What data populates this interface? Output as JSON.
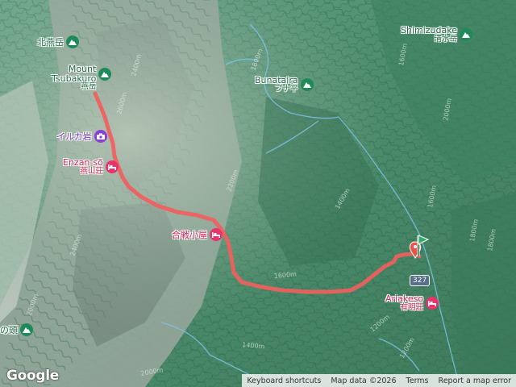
{
  "map": {
    "provider_logo": "Google",
    "route_color": "#f0605e",
    "start_flag_color": "#3aa86a",
    "end_marker_color": "#e8534a",
    "road_number": "327"
  },
  "places": [
    {
      "id": "kitatsubakurodake",
      "name": "北燕岳",
      "sub": "",
      "icon": "mountain-icon",
      "category": "peak"
    },
    {
      "id": "tsubakuro",
      "name": "Mount",
      "name2": "Tsubakuro",
      "sub": "燕岳",
      "icon": "mountain-icon",
      "category": "peak"
    },
    {
      "id": "iruka",
      "name": "イルカ岩",
      "sub": "",
      "icon": "camera-icon",
      "category": "sight"
    },
    {
      "id": "enzanso",
      "name": "Enzan-sō",
      "sub": "燕山荘",
      "icon": "bed-icon",
      "category": "lodging"
    },
    {
      "id": "kassen",
      "name": "合戦小屋",
      "sub": "",
      "icon": "bed-icon",
      "category": "lodging"
    },
    {
      "id": "bunataira",
      "name": "Bunataira",
      "sub": "ブナ平",
      "icon": "mountain-icon",
      "category": "peak"
    },
    {
      "id": "shimizudake",
      "name": "Shimizudake",
      "sub": "清水岳",
      "icon": "mountain-icon",
      "category": "peak"
    },
    {
      "id": "ariakeso",
      "name": "Ariakeso",
      "sub": "有明荘",
      "icon": "bed-icon",
      "category": "lodging"
    },
    {
      "id": "nokashira",
      "name": "の頭",
      "sub": "",
      "icon": "mountain-icon",
      "category": "peak"
    }
  ],
  "attribution": {
    "keyboard": "Keyboard shortcuts",
    "mapdata": "Map data ©2026",
    "terms": "Terms",
    "report": "Report a map error"
  },
  "contours": [
    "2400m",
    "2600m",
    "2400m",
    "2200m",
    "2000m",
    "1800m",
    "1600m",
    "1400m",
    "1200m",
    "2000m",
    "1800m",
    "1600m",
    "1800m",
    "1600m",
    "1400m",
    "1200m",
    "2000m"
  ]
}
